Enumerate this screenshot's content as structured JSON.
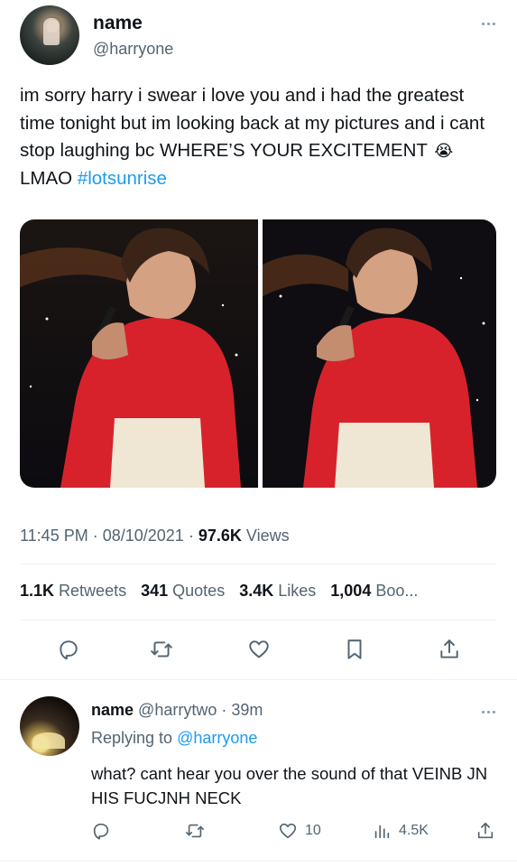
{
  "tweet": {
    "display_name": "name",
    "handle": "@harryone",
    "text_main": "im sorry harry i swear i love you and i had the greatest time tonight but im looking back at my pictures and i cant stop laughing bc WHERE’S YOUR EXCITEMENT",
    "emoji": "😭",
    "text_after_emoji": "LMAO",
    "hashtag": "#lotsunrise",
    "time": "11:45 PM",
    "date": "08/10/2021",
    "views_count": "97.6K",
    "views_label": "Views",
    "retweets_count": "1.1K",
    "retweets_label": "Retweets",
    "quotes_count": "341",
    "quotes_label": "Quotes",
    "likes_count": "3.4K",
    "likes_label": "Likes",
    "bookmarks_count": "1,004",
    "bookmarks_label": "Boo..."
  },
  "reply": {
    "display_name": "name",
    "handle": "@harrytwo",
    "time": "39m",
    "replying_prefix": "Replying to",
    "replying_to": "@harryone",
    "text": "what? cant hear you over the sound of that VEINB JN HIS FUCJNH NECK",
    "likes": "10",
    "views": "4.5K"
  },
  "icons": {
    "reply": "reply-icon",
    "retweet": "retweet-icon",
    "like": "heart-icon",
    "bookmark": "bookmark-icon",
    "share": "share-icon",
    "views": "views-icon",
    "more": "more-icon"
  },
  "colors": {
    "link": "#1d9bf0",
    "secondary_text": "#536471",
    "primary_text": "#0f1419"
  }
}
